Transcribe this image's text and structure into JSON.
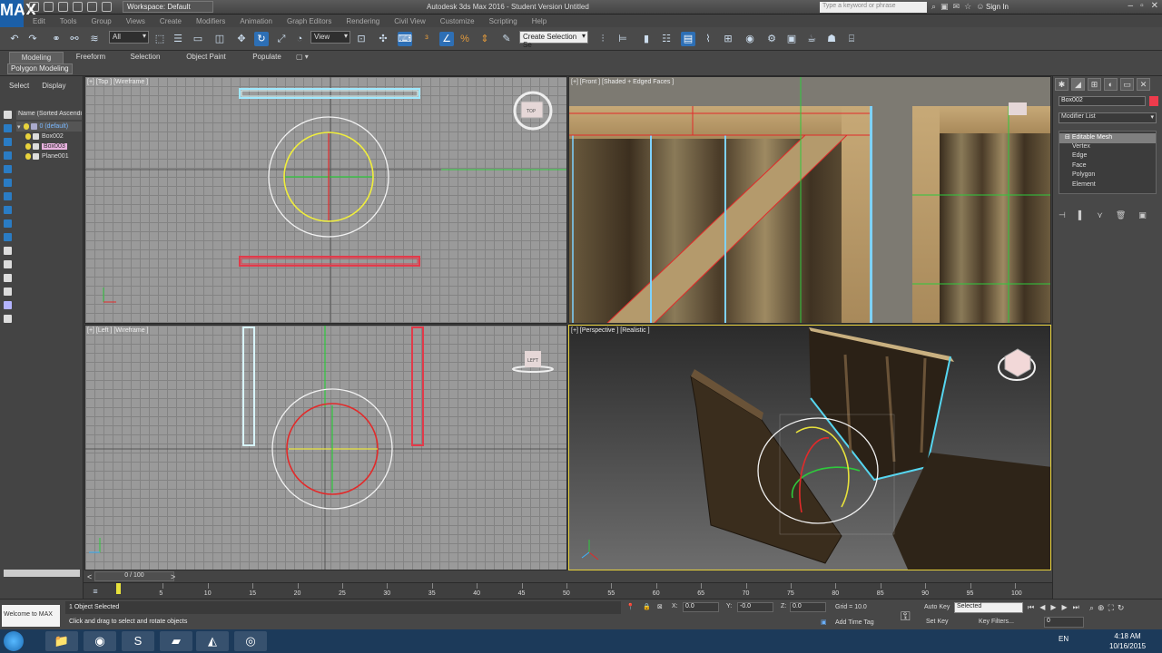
{
  "title_bar": {
    "logo": "MAX",
    "logo_sub": "",
    "workspace": "Workspace: Default",
    "app_title": "Autodesk 3ds Max 2016 - Student Version   Untitled",
    "search_placeholder": "Type a keyword or phrase",
    "sign_in": "Sign In"
  },
  "menu": [
    "Edit",
    "Tools",
    "Group",
    "Views",
    "Create",
    "Modifiers",
    "Animation",
    "Graph Editors",
    "Rendering",
    "Civil View",
    "Customize",
    "Scripting",
    "Help"
  ],
  "toolbar": {
    "selection_filter": "All",
    "ref_coord": "View",
    "named_selection": "Create Selection Se"
  },
  "ribbon": {
    "tabs": [
      "Modeling",
      "Freeform",
      "Selection",
      "Object Paint",
      "Populate"
    ],
    "pin": "▢ ▾",
    "sub_label": "Polygon Modeling"
  },
  "scene_explorer": {
    "tabs": [
      "Select",
      "Display"
    ],
    "header": "Name (Sorted Ascending)",
    "items": [
      "0 (default)",
      "Box002",
      "Box003",
      "Plane001"
    ]
  },
  "viewports": {
    "top": "[+] [Top ] [Wireframe ]",
    "front": "[+] [Front ] [Shaded + Edged Faces ]",
    "left": "[+] [Left ] [Wireframe ]",
    "perspective": "[+] [Perspective ] [Realistic ]"
  },
  "command_panel": {
    "object_name": "Box002",
    "object_color": "#ee3b4c",
    "modifier_list": "Modifier List",
    "stack": [
      "Editable Mesh",
      "Vertex",
      "Edge",
      "Face",
      "Polygon",
      "Element"
    ]
  },
  "timeline": {
    "frame_display": "0 / 100",
    "ticks": [
      "5",
      "10",
      "15",
      "20",
      "25",
      "30",
      "35",
      "40",
      "45",
      "50",
      "55",
      "60",
      "65",
      "70",
      "75",
      "80",
      "85",
      "90",
      "95",
      "100"
    ]
  },
  "status": {
    "welcome": "Welcome to MAX",
    "selected_count": "1 Object Selected",
    "prompt": "Click and drag to select and rotate objects",
    "x_label": "X:",
    "x_value": "0.0",
    "y_label": "Y:",
    "y_value": "-0.0",
    "z_label": "Z:",
    "z_value": "0.0",
    "grid": "Grid = 10.0",
    "add_time_tag": "Add Time Tag",
    "auto_key": "Auto Key",
    "set_key": "Set Key",
    "selection_set": "Selected",
    "key_filters": "Key Filters...",
    "frame": "0"
  },
  "taskbar": {
    "language": "EN",
    "time": "4:18 AM",
    "date": "10/16/2015"
  },
  "colors": {
    "accent_blue": "#2d6fb5",
    "viewport_active_border": "#e8d23c",
    "selection_red": "#ee3b4c"
  }
}
